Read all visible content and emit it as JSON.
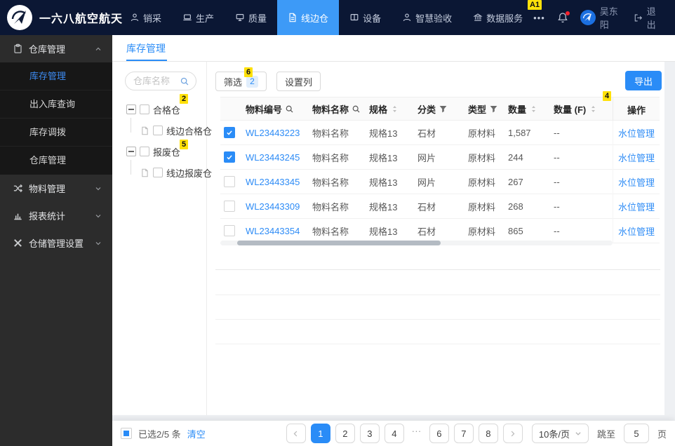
{
  "navbar": {
    "brand": "一六八航空航天",
    "items": [
      {
        "label": "销采",
        "icon": "person",
        "active": false
      },
      {
        "label": "生产",
        "icon": "laptop",
        "active": false
      },
      {
        "label": "质量",
        "icon": "monitor",
        "active": false
      },
      {
        "label": "线边仓",
        "icon": "file",
        "active": true
      },
      {
        "label": "设备",
        "icon": "book",
        "active": false
      },
      {
        "label": "智慧验收",
        "icon": "person",
        "active": false
      },
      {
        "label": "数据服务",
        "icon": "bank",
        "active": false
      }
    ],
    "more": "•••",
    "user": "吴东阳",
    "logout": "退出"
  },
  "sidebar": {
    "group1": {
      "label": "仓库管理",
      "children": [
        "库存管理",
        "出入库查询",
        "库存调拨",
        "仓库管理"
      ],
      "active": "库存管理"
    },
    "group2": "物料管理",
    "group3": "报表统计",
    "group4": "仓储管理设置"
  },
  "tab": "库存管理",
  "tree": {
    "placeholder": "仓库名称",
    "node1": {
      "label": "合格仓",
      "child": "线边合格仓"
    },
    "node2": {
      "label": "报废仓",
      "child": "线边报废仓"
    }
  },
  "toolbar": {
    "filter": "筛选",
    "filter_count": "2",
    "columns": "设置列",
    "export": "导出"
  },
  "annotations": {
    "nav": "A1",
    "filter": "6",
    "tree1": "2",
    "tree2": "5",
    "table": "4"
  },
  "table": {
    "headers": {
      "code": "物料编号",
      "name": "物料名称",
      "spec": "规格",
      "category": "分类",
      "type": "类型",
      "qty": "数量",
      "qty_f": "数量 (F)",
      "ops": "操作"
    },
    "rows": [
      {
        "checked": true,
        "code": "WL23443223",
        "name": "物料名称",
        "spec": "规格13",
        "category": "石材",
        "type": "原材料",
        "qty": "1,587",
        "qty_f": "--",
        "action": "水位管理"
      },
      {
        "checked": true,
        "code": "WL23443245",
        "name": "物料名称",
        "spec": "规格13",
        "category": "网片",
        "type": "原材料",
        "qty": "244",
        "qty_f": "--",
        "action": "水位管理"
      },
      {
        "checked": false,
        "code": "WL23443345",
        "name": "物料名称",
        "spec": "规格13",
        "category": "网片",
        "type": "原材料",
        "qty": "267",
        "qty_f": "--",
        "action": "水位管理"
      },
      {
        "checked": false,
        "code": "WL23443309",
        "name": "物料名称",
        "spec": "规格13",
        "category": "石材",
        "type": "原材料",
        "qty": "268",
        "qty_f": "--",
        "action": "水位管理"
      },
      {
        "checked": false,
        "code": "WL23443354",
        "name": "物料名称",
        "spec": "规格13",
        "category": "石材",
        "type": "原材料",
        "qty": "865",
        "qty_f": "--",
        "action": "水位管理"
      }
    ]
  },
  "footer": {
    "selected": "已选2/5 条",
    "clear": "清空",
    "pages": [
      "1",
      "2",
      "3",
      "4",
      "...",
      "6",
      "7",
      "8"
    ],
    "active_page": "1",
    "page_size": "10条/页",
    "jump_label": "跳至",
    "jump_value": "5",
    "jump_suffix": "页"
  },
  "colors": {
    "accent": "#2a8cf7",
    "nav_bg": "#0b1734",
    "sidebar_bg": "#2c2c2c",
    "badge_yellow": "#ffe10a"
  }
}
